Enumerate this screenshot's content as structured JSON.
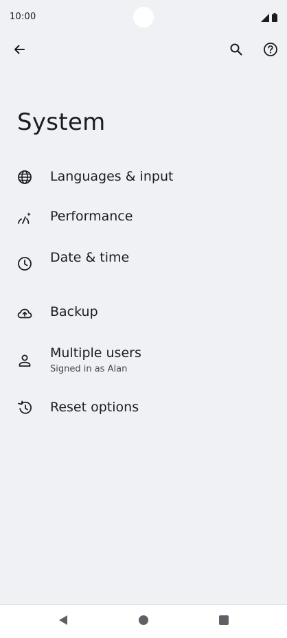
{
  "status_bar": {
    "time": "10:00",
    "icons": [
      "signal-icon",
      "battery-icon"
    ]
  },
  "top_bar": {
    "icons": [
      "back-arrow-icon",
      "search-icon",
      "help-icon"
    ]
  },
  "page": {
    "title": "System"
  },
  "settings": [
    {
      "label": "Languages & input",
      "icon": "globe-icon"
    },
    {
      "label": "Performance",
      "icon": "performance-icon"
    },
    {
      "label": "Date & time",
      "icon": "clock-icon"
    },
    {
      "label": "Backup",
      "icon": "cloud-upload-icon"
    },
    {
      "label": "Multiple users",
      "subtitle": "Signed in as Alan",
      "icon": "person-icon"
    },
    {
      "label": "Reset options",
      "icon": "history-icon"
    }
  ],
  "nav_bar": {
    "icons": [
      "nav-back-icon",
      "nav-home-icon",
      "nav-recents-icon"
    ]
  },
  "colors": {
    "background": "#f0f1f4",
    "text": "#1b1c1f",
    "subtext": "#45474c",
    "nav_bar": "#ffffff"
  }
}
